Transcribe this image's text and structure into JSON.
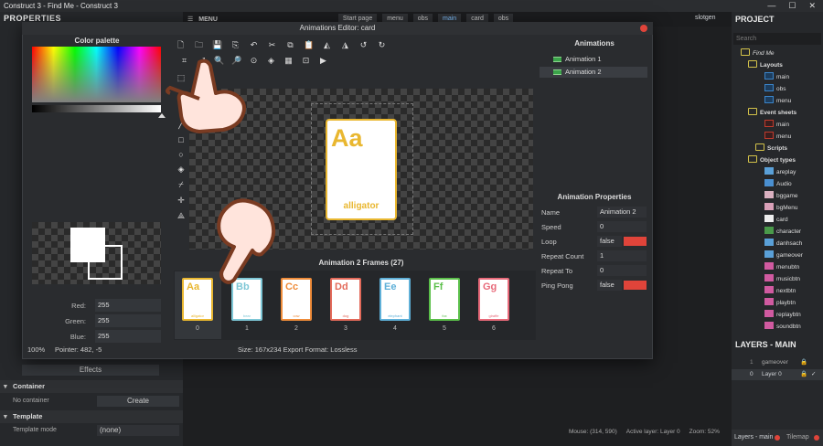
{
  "window": {
    "title": "Construct 3 - Find Me - Construct 3",
    "user": "slotgen"
  },
  "left_panel": {
    "title": "PROPERTIES",
    "rows": [
      {
        "label": "Red:",
        "value": "255"
      },
      {
        "label": "Green:",
        "value": "255"
      },
      {
        "label": "Blue:",
        "value": "255"
      }
    ],
    "sections": {
      "effects": "Effects",
      "container": "Container",
      "template": "Template"
    },
    "effects_button": "Effects",
    "no_container": "No container",
    "create_button": "Create",
    "template_mode_label": "Template mode",
    "template_mode_value": "(none)"
  },
  "menubar": {
    "menu_label": "MENU",
    "tabs": [
      "Start page",
      "menu",
      "obs",
      "main",
      "card",
      "obs"
    ],
    "active_tab": "main"
  },
  "dialog": {
    "title": "Animations Editor: card",
    "color_palette_title": "Color palette",
    "rgb": [
      {
        "label": "Red:",
        "value": "255"
      },
      {
        "label": "Green:",
        "value": "255"
      },
      {
        "label": "Blue:",
        "value": "255"
      }
    ],
    "zoom": "100%",
    "pointer": "Pointer: 482, -5",
    "frames_title": "Animation 2 Frames (27)",
    "size_text": "Size: 167x234   Export Format: Lossless",
    "big_card": {
      "letters": "Aa",
      "word": "alligator",
      "color": "#e9b730"
    },
    "frames": [
      {
        "letters": "Aa",
        "word": "alligator",
        "color": "#e9b730",
        "num": "0"
      },
      {
        "letters": "Bb",
        "word": "bear",
        "color": "#7ec7d6",
        "num": "1"
      },
      {
        "letters": "Cc",
        "word": "cow",
        "color": "#ef8c3a",
        "num": "2"
      },
      {
        "letters": "Dd",
        "word": "dog",
        "color": "#e36a5a",
        "num": "3"
      },
      {
        "letters": "Ee",
        "word": "elephant",
        "color": "#5fb0d8",
        "num": "4"
      },
      {
        "letters": "Ff",
        "word": "fox",
        "color": "#5bbf4a",
        "num": "5"
      },
      {
        "letters": "Gg",
        "word": "giraffe",
        "color": "#e86a7a",
        "num": "6"
      }
    ],
    "animations_title": "Animations",
    "animations": [
      "Animation 1",
      "Animation 2"
    ],
    "properties_title": "Animation Properties",
    "properties": [
      {
        "key": "Name",
        "value": "Animation 2"
      },
      {
        "key": "Speed",
        "value": "0"
      },
      {
        "key": "Loop",
        "value": "false"
      },
      {
        "key": "Repeat Count",
        "value": "1"
      },
      {
        "key": "Repeat To",
        "value": "0"
      },
      {
        "key": "Ping Pong",
        "value": "false"
      }
    ]
  },
  "project": {
    "title": "PROJECT",
    "search_placeholder": "Search",
    "root": "Find Me",
    "layouts_label": "Layouts",
    "layouts": [
      "main",
      "obs",
      "menu"
    ],
    "event_sheets_label": "Event sheets",
    "event_sheets": [
      "main",
      "menu"
    ],
    "scripts_label": "Scripts",
    "object_types_label": "Object types",
    "objects": [
      "areplay",
      "Audio",
      "bggame",
      "bgMenu",
      "card",
      "character",
      "danhsach",
      "gameover",
      "menubtn",
      "musicbtn",
      "nextbtn",
      "playbtn",
      "replaybtn",
      "soundbtn"
    ]
  },
  "layers": {
    "title": "LAYERS - MAIN",
    "rows": [
      {
        "num": "1",
        "name": "gameover"
      },
      {
        "num": "0",
        "name": "Layer 0"
      }
    ],
    "tab_layers": "Layers - main",
    "tab_tilemap": "Tilemap"
  },
  "status": {
    "mouse": "Mouse: (314, 590)",
    "active_layer": "Active layer: Layer 0",
    "zoom": "Zoom: 52%"
  }
}
